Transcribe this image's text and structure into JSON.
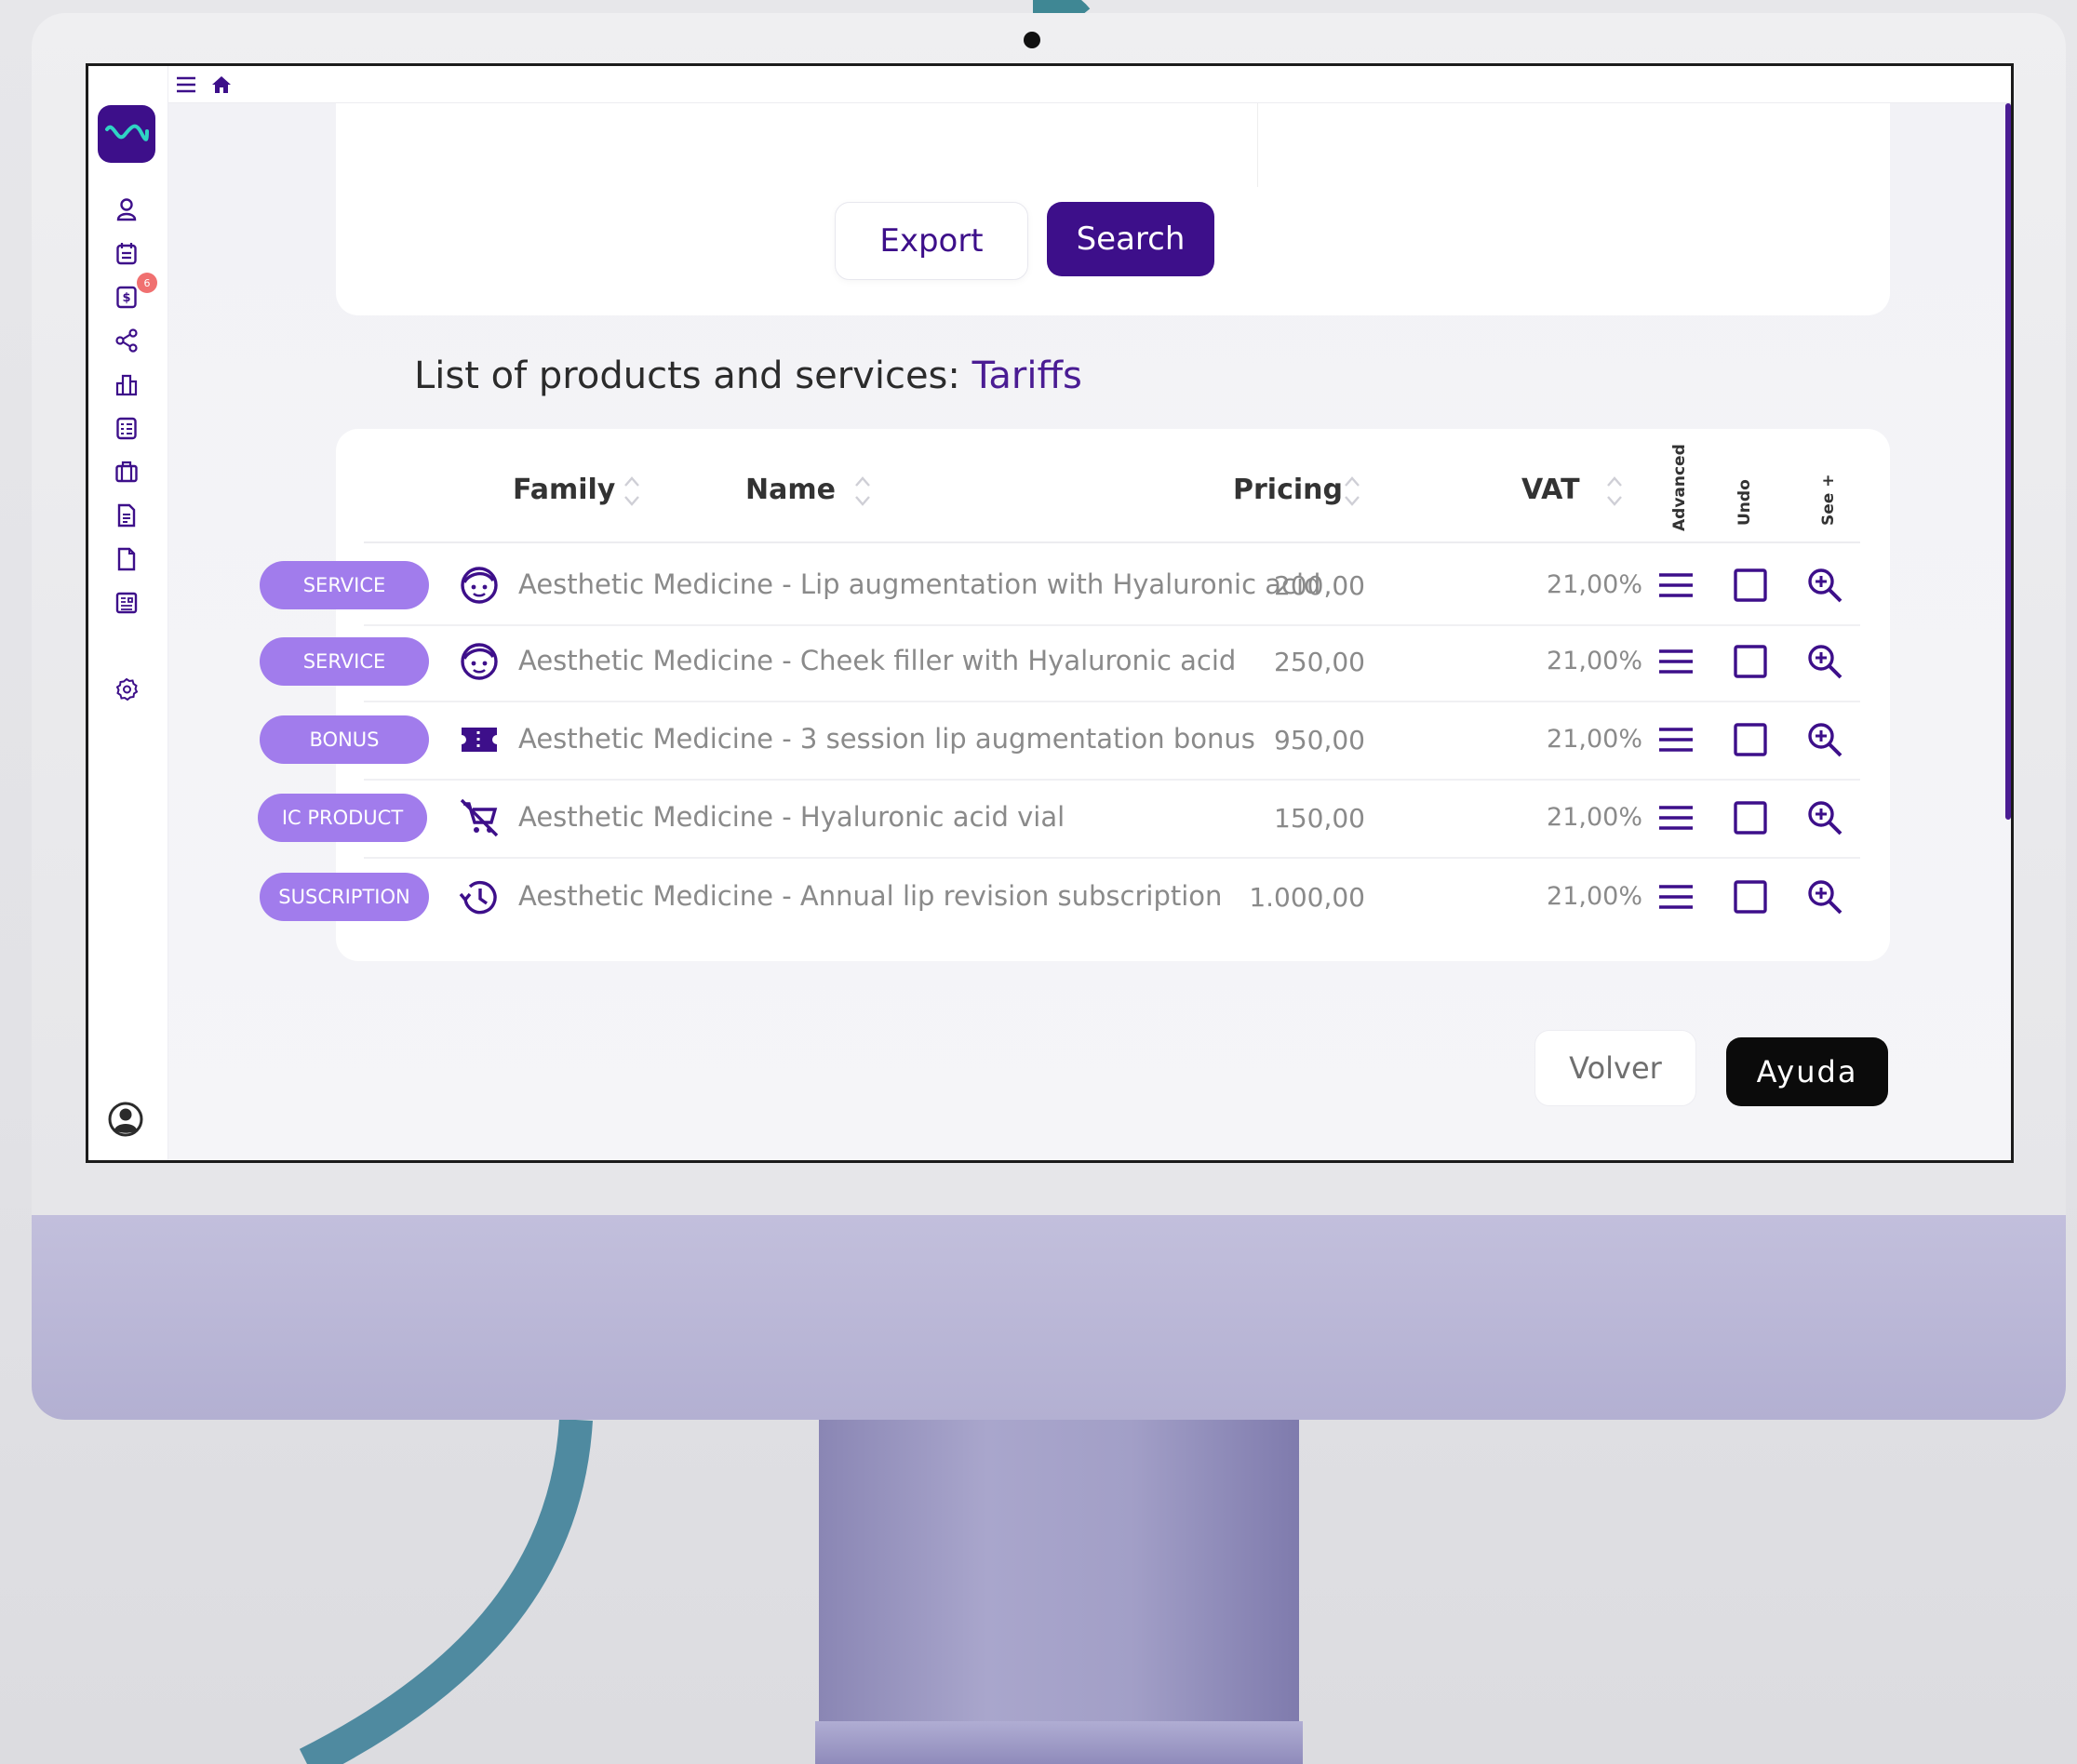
{
  "topbar": {
    "menu_icon": "hamburger-icon",
    "home_icon": "home-icon"
  },
  "sidebar": {
    "logo_icon": "wave-logo",
    "items": [
      {
        "icon": "user-icon"
      },
      {
        "icon": "calendar-icon"
      },
      {
        "icon": "invoice-icon",
        "badge": "6"
      },
      {
        "icon": "share-icon"
      },
      {
        "icon": "building-icon"
      },
      {
        "icon": "checklist-icon"
      },
      {
        "icon": "briefcase-icon"
      },
      {
        "icon": "document-icon"
      },
      {
        "icon": "file-icon"
      },
      {
        "icon": "report-icon"
      },
      {
        "icon": "settings-gear-icon"
      }
    ],
    "profile_icon": "user-circle-icon"
  },
  "actions": {
    "export_label": "Export",
    "search_label": "Search"
  },
  "list": {
    "title": "List of products and services: ",
    "title_highlight": "Tariffs"
  },
  "table": {
    "columns": {
      "family": "Family",
      "name": "Name",
      "pricing": "Pricing",
      "vat": "VAT",
      "advanced": "Advanced",
      "undo": "Undo",
      "see_more": "See +"
    },
    "rows": [
      {
        "family": "SERVICE",
        "icon": "face-icon",
        "name": "Aesthetic Medicine - Lip augmentation with Hyaluronic acid",
        "pricing": "200,00",
        "vat": "21,00%"
      },
      {
        "family": "SERVICE",
        "icon": "face-icon",
        "name": "Aesthetic Medicine - Cheek filler with Hyaluronic acid",
        "pricing": "250,00",
        "vat": "21,00%"
      },
      {
        "family": "BONUS",
        "icon": "ticket-icon",
        "name": "Aesthetic Medicine - 3 session lip augmentation bonus",
        "pricing": "950,00",
        "vat": "21,00%"
      },
      {
        "family": "IC PRODUCT",
        "icon": "cart-off-icon",
        "name": "Aesthetic Medicine - Hyaluronic acid vial",
        "pricing": "150,00",
        "vat": "21,00%"
      },
      {
        "family": "SUSCRIPTION",
        "icon": "history-icon",
        "name": "Aesthetic Medicine - Annual lip revision subscription",
        "pricing": "1.000,00",
        "vat": "21,00%"
      }
    ]
  },
  "footer": {
    "back_label": "Volver",
    "help_label": "Ayuda"
  },
  "colors": {
    "brand": "#3d0f8a",
    "pill": "#a17cec",
    "accent": "#4a1c93",
    "badge": "#f07070"
  }
}
